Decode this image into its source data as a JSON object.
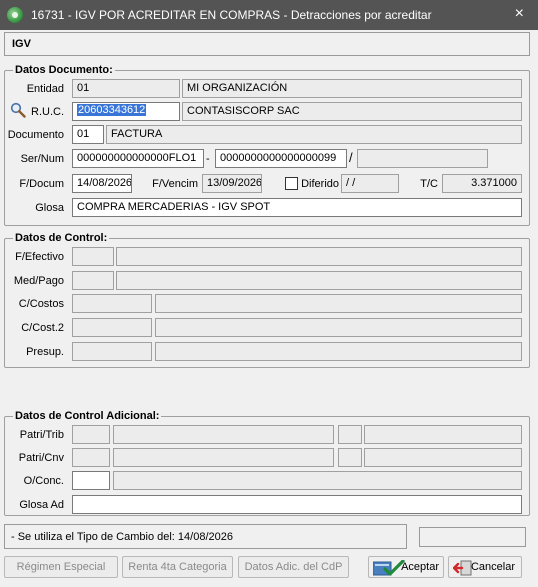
{
  "window": {
    "title": "16731 - IGV POR ACREDITAR EN COMPRAS - Detracciones por acreditar",
    "close_glyph": "×"
  },
  "igv_bar": {
    "label": "IGV"
  },
  "datos_documento": {
    "title": "Datos Documento:",
    "entidad": {
      "label": "Entidad",
      "code": "01",
      "name": "MI ORGANIZACIÓN"
    },
    "ruc": {
      "label": "R.U.C.",
      "value": "20603343612",
      "name": "CONTASISCORP SAC"
    },
    "documento": {
      "label": "Documento",
      "code": "01",
      "name": "FACTURA"
    },
    "sernum": {
      "label": "Ser/Num",
      "serie": "000000000000000FLO1",
      "dash": "-",
      "numero": "0000000000000000099",
      "slash": "/",
      "extra": ""
    },
    "fdocum": {
      "label": "F/Docum",
      "value": "14/08/2026"
    },
    "fvencim": {
      "label": "F/Vencim",
      "value": "13/09/2026"
    },
    "diferido": {
      "label": "Diferido",
      "value": " /  /"
    },
    "tc": {
      "label": "T/C",
      "value": "3.371000"
    },
    "glosa": {
      "label": "Glosa",
      "value": "COMPRA MERCADERIAS - IGV SPOT"
    }
  },
  "datos_control": {
    "title": "Datos de Control:",
    "rows": [
      {
        "label": "F/Efectivo"
      },
      {
        "label": "Med/Pago"
      },
      {
        "label": "C/Costos"
      },
      {
        "label": "C/Cost.2"
      },
      {
        "label": "Presup."
      }
    ]
  },
  "datos_control_adicional": {
    "title": "Datos de Control Adicional:",
    "patri_trib": {
      "label": "Patri/Trib"
    },
    "patri_cnv": {
      "label": "Patri/Cnv"
    },
    "o_conc": {
      "label": "O/Conc."
    },
    "glosa_ad": {
      "label": "Glosa Ad"
    }
  },
  "status": {
    "message": "- Se utiliza el Tipo de Cambio del: 14/08/2026"
  },
  "buttons": {
    "regimen": "Régimen Especial",
    "renta": "Renta 4ta Categoria",
    "datos_adic": "Datos Adic. del CdP",
    "aceptar": "Aceptar",
    "cancelar": "Cancelar"
  },
  "icons": {
    "app": "app-logo-icon",
    "search": "magnifier-icon",
    "accept": "accept-icon",
    "cancel": "cancel-icon"
  }
}
